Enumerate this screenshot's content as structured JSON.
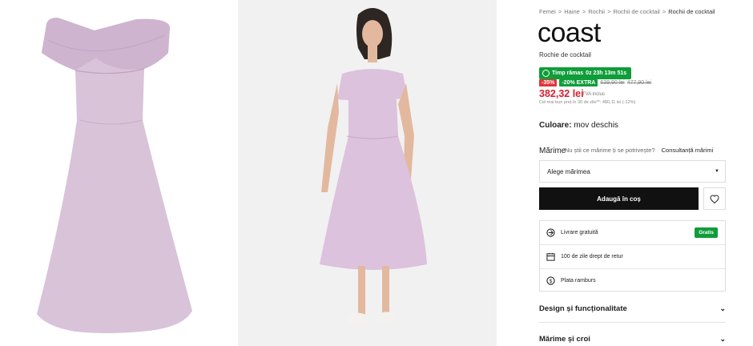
{
  "breadcrumbs": [
    "Femei",
    "Haine",
    "Rochii",
    "Rochii de cocktail",
    "Rochii de cocktail"
  ],
  "brand": "coast",
  "product_name": "Rochie de cocktail",
  "timer": {
    "label": "Timp rămas",
    "value": "0z 23h 13m 51s"
  },
  "discounts": {
    "percent": "-35%",
    "extra": "-20% EXTRA",
    "old_price_1": "639,90 lei",
    "old_price_2": "477,90 lei"
  },
  "price": {
    "value": "382,32 lei",
    "vat": "TVA inclus",
    "lowest": "Cel mai bun preț în 30 de zile**: 480,11 lei (-12%)"
  },
  "color": {
    "label": "Culoare:",
    "value": "mov deschis"
  },
  "size": {
    "label": "Mărime",
    "help": "Nu știi ce mărime ți se potrivește?",
    "advice": "Consultanță mărimi",
    "placeholder": "Alege mărimea"
  },
  "cart_button": "Adaugă în coș",
  "services": [
    {
      "label": "Livrare gratuită",
      "badge": "Gratis",
      "icon": "delivery-icon"
    },
    {
      "label": "100 de zile drept de retur",
      "icon": "calendar-icon"
    },
    {
      "label": "Plata ramburs",
      "icon": "cash-icon"
    }
  ],
  "accordions": [
    "Design și funcționalitate",
    "Mărime și croi"
  ],
  "colors": {
    "accent_green": "#0f9d3a",
    "price_red": "#d6202f",
    "dress": "#d8bfd8"
  }
}
